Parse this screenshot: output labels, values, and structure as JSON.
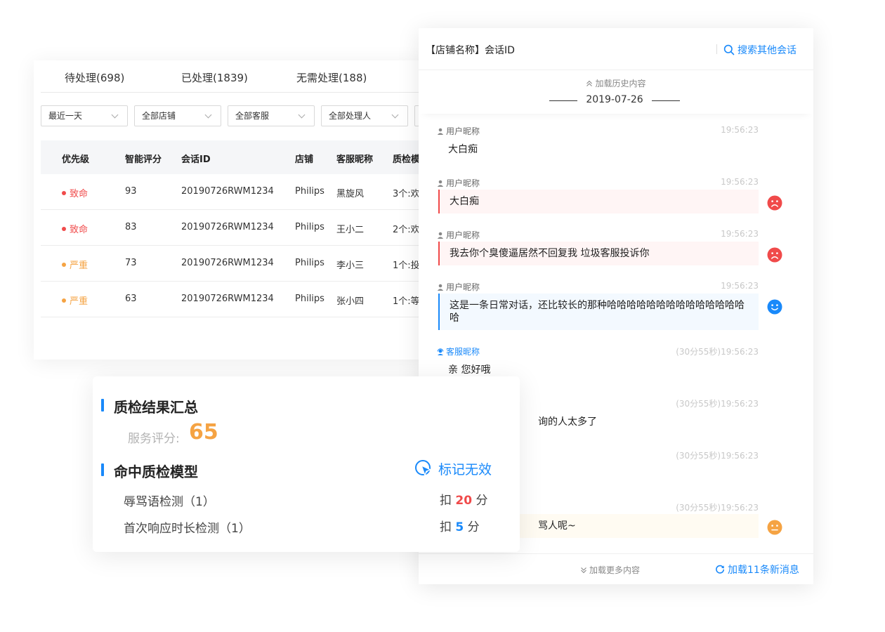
{
  "table": {
    "tabs": [
      "待处理(698)",
      "已处理(1839)",
      "无需处理(188)"
    ],
    "filters": [
      "最近一天",
      "全部店铺",
      "全部客服",
      "全部处理人"
    ],
    "columns": [
      "优先级",
      "智能评分",
      "会话ID",
      "店铺",
      "客服昵称",
      "质检模"
    ],
    "rows": [
      {
        "priority": "致命",
        "score": "93",
        "session": "20190726RWM1234",
        "shop": "Philips",
        "agent": "黑旋风",
        "model": "3个:欢"
      },
      {
        "priority": "致命",
        "score": "83",
        "session": "20190726RWM1234",
        "shop": "Philips",
        "agent": "王小二",
        "model": "2个:欢"
      },
      {
        "priority": "严重",
        "score": "73",
        "session": "20190726RWM1234",
        "shop": "Philips",
        "agent": "李小三",
        "model": "1个:投"
      },
      {
        "priority": "严重",
        "score": "63",
        "session": "20190726RWM1234",
        "shop": "Philips",
        "agent": "张小四",
        "model": "1个:等"
      }
    ]
  },
  "summary": {
    "title": "质检结果汇总",
    "score_label": "服务评分:",
    "score_value": "65",
    "models_title": "命中质检模型",
    "mark_invalid": "标记无效",
    "models": [
      {
        "name": "辱骂语检测（1）",
        "prefix": "扣",
        "points": "20",
        "suffix": "分"
      },
      {
        "name": "首次响应时长检测（1）",
        "prefix": "扣",
        "points": "5",
        "suffix": "分"
      }
    ]
  },
  "chat": {
    "title": "【店铺名称】会话ID",
    "search": "搜索其他会话",
    "load_history": "加载历史内容",
    "date": "2019-07-26",
    "messages": [
      {
        "sender": "用户昵称",
        "time": "19:56:23",
        "text": "大白痴"
      },
      {
        "sender": "用户昵称",
        "time": "19:56:23",
        "text": "大白痴"
      },
      {
        "sender": "用户昵称",
        "time": "19:56:23",
        "text": "我去你个臭傻逼居然不回复我 垃圾客服投诉你"
      },
      {
        "sender": "用户昵称",
        "time": "19:56:23",
        "text": "这是一条日常对话，还比较长的那种哈哈哈哈哈哈哈哈哈哈哈哈哈哈哈"
      },
      {
        "sender": "客服昵称",
        "time": "(30分55秒)19:56:23",
        "text": "亲 您好哦"
      },
      {
        "sender": "",
        "time": "(30分55秒)19:56:23",
        "text": "询的人太多了"
      },
      {
        "sender": "",
        "time": "(30分55秒)19:56:23",
        "text": ""
      },
      {
        "sender": "",
        "time": "(30分55秒)19:56:23",
        "text": "骂人呢~"
      }
    ],
    "load_more": "加载更多内容",
    "load_new": "加载11条新消息"
  },
  "colors": {
    "accent": "#1989fa",
    "fatal": "#f04a4a",
    "serious": "#f5a343"
  }
}
